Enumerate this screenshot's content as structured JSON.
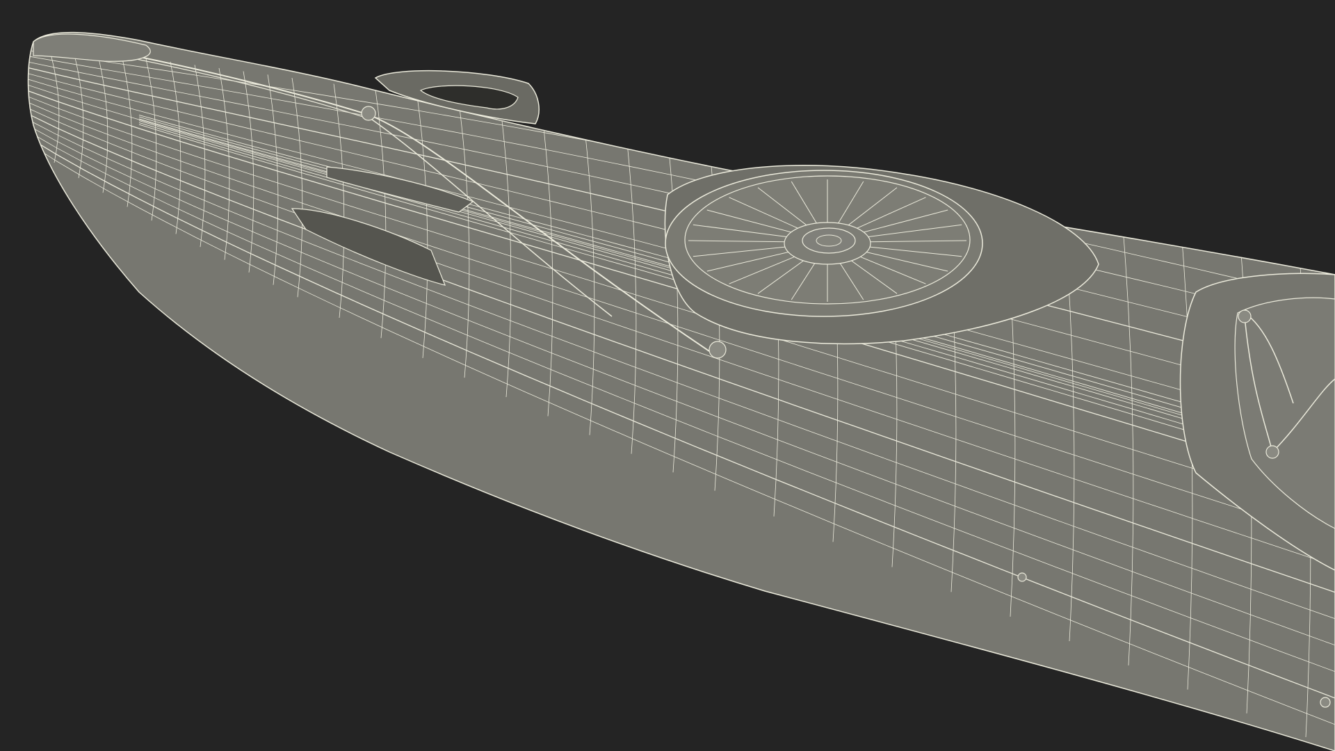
{
  "scene": {
    "subject": "kayak-bow-wireframe",
    "background_color": "#242424",
    "hull_color": "#777770",
    "hull_shadow_color": "#6a6a63",
    "hull_light_color": "#82827a",
    "wire_color": "#ecebdc",
    "recess_color": "#55554f"
  }
}
